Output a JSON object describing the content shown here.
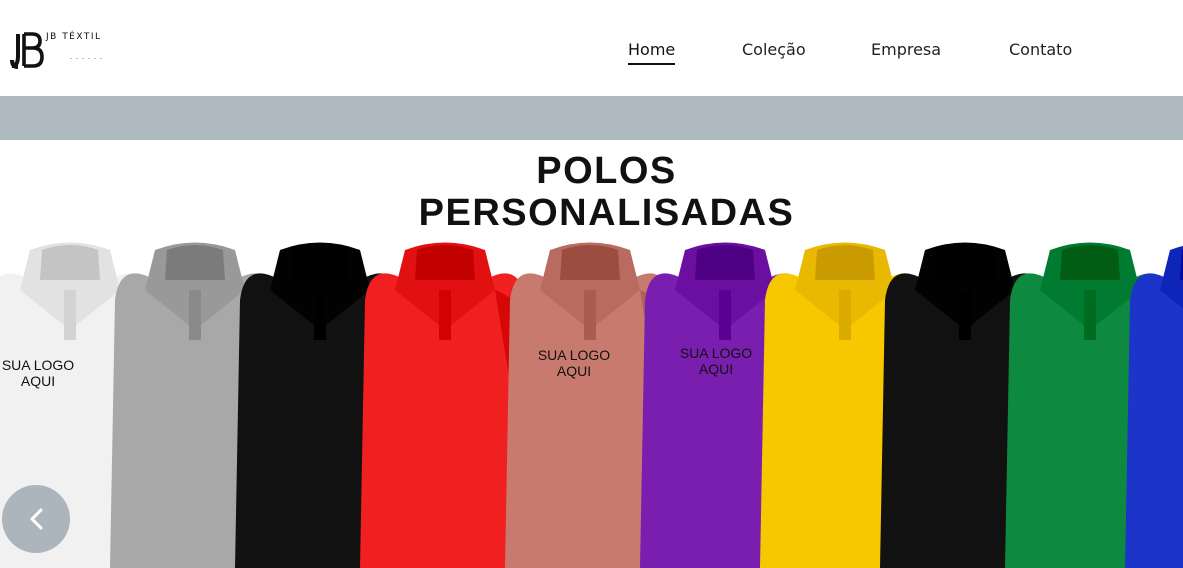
{
  "brand": {
    "name": "JB TÉXTIL",
    "logo_icon": "jb-monogram-logo"
  },
  "nav": {
    "items": [
      {
        "label": "Home",
        "active": true
      },
      {
        "label": "Coleção",
        "active": false
      },
      {
        "label": "Empresa",
        "active": false
      },
      {
        "label": "Contato",
        "active": false
      }
    ]
  },
  "hero": {
    "title_line1": "POLOS",
    "title_line2": "PERSONALISADAS",
    "shirt_colors": [
      "#f1f1f1",
      "#a8a8a8",
      "#111111",
      "#f02020",
      "#c97a6e",
      "#7a1eb0",
      "#f7c800",
      "#111111",
      "#0e8a40",
      "#1c35c8"
    ],
    "logo_placeholder_line1": "SUA LOGO",
    "logo_placeholder_line2": "AQUI",
    "prev_icon": "chevron-left-icon"
  },
  "colors": {
    "strip": "#b0bbc1",
    "nav_text": "#222222"
  }
}
